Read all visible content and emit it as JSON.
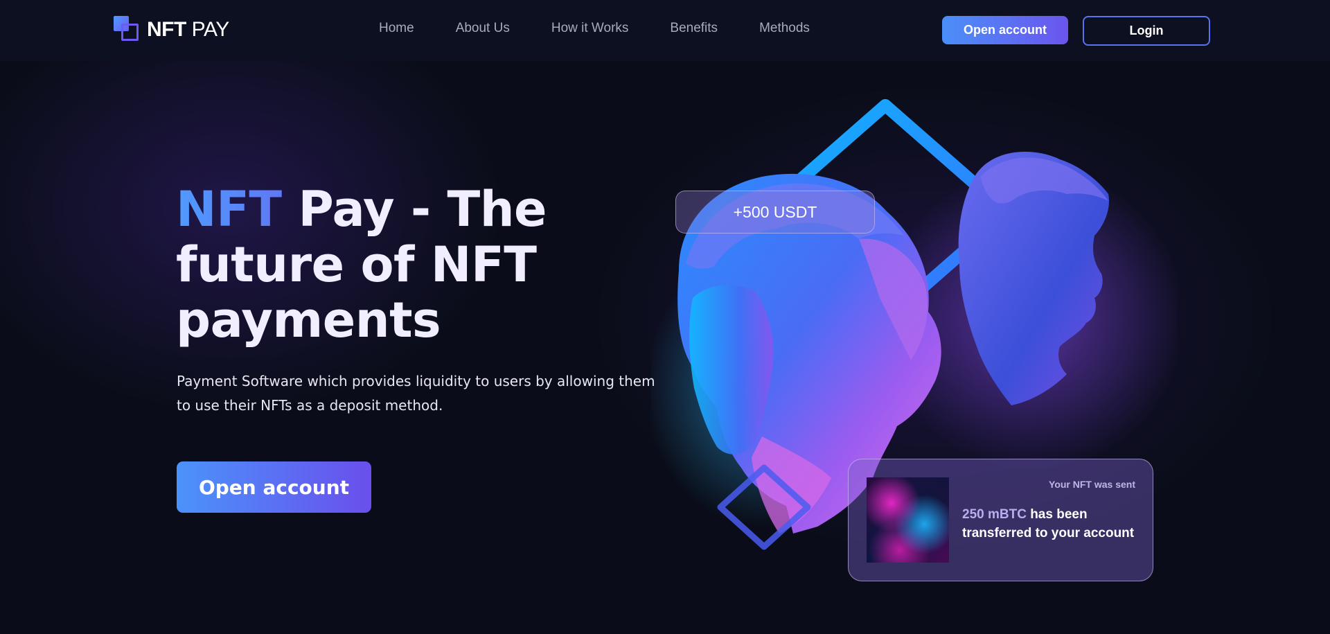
{
  "nav": {
    "logo_bold": "NFT",
    "logo_light": "PAY",
    "links": [
      "Home",
      "About Us",
      "How it Works",
      "Benefits",
      "Methods"
    ],
    "open_account_label": "Open account",
    "login_label": "Login"
  },
  "hero": {
    "title_accent": "NFT",
    "title_rest": "Pay - The future of NFT payments",
    "subtitle": "Payment Software which provides liquidity to users by allowing them to use their NFTs as a deposit method.",
    "cta_label": "Open account"
  },
  "art": {
    "usdt_badge": "+500 USDT",
    "card_status": "Your NFT was sent",
    "card_amount": "250 mBTC",
    "card_message": "has been transferred to your account"
  },
  "colors": {
    "background": "#0a0d19",
    "accent_blue": "#4f9bff",
    "accent_purple": "#6a4fec"
  },
  "icons": {
    "logo": "nft-pay-logo-icon"
  }
}
